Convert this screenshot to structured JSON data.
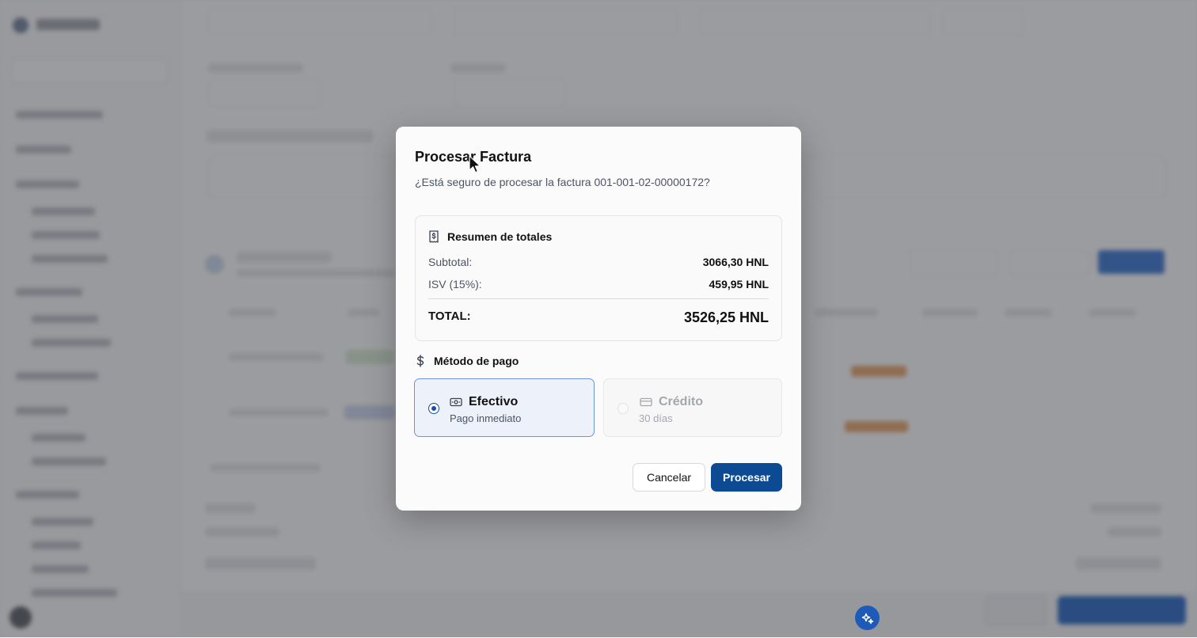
{
  "dialog": {
    "title": "Procesar Factura",
    "description": "¿Está seguro de procesar la factura 001-001-02-00000172?",
    "summary": {
      "heading": "Resumen de totales",
      "subtotal_label": "Subtotal:",
      "subtotal_value": "3066,30 HNL",
      "tax_label": "ISV (15%):",
      "tax_value": "459,95 HNL",
      "total_label": "TOTAL:",
      "total_value": "3526,25 HNL"
    },
    "payment": {
      "heading": "Método de pago",
      "options": [
        {
          "label": "Efectivo",
          "sub": "Pago inmediato",
          "selected": true
        },
        {
          "label": "Crédito",
          "sub": "30 días",
          "selected": false
        }
      ]
    },
    "cancel_label": "Cancelar",
    "confirm_label": "Procesar"
  },
  "colors": {
    "primary": "#0c4a94",
    "selected_border": "#6d94d6",
    "selected_bg": "#edf2fa",
    "overlay": "rgba(55,58,64,0.5)"
  }
}
